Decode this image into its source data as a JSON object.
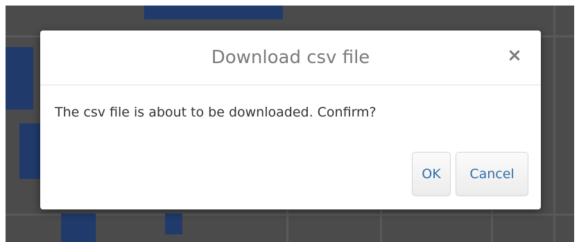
{
  "dialog": {
    "title": "Download csv file",
    "close_glyph": "×",
    "message": "The csv file is about to be downloaded. Confirm?",
    "ok_label": "OK",
    "cancel_label": "Cancel"
  },
  "icons": {
    "close": "close-icon"
  },
  "colors": {
    "link_text": "#2f6fa8",
    "title_text": "#7a7a7a",
    "backdrop": "#4b4b4b"
  }
}
